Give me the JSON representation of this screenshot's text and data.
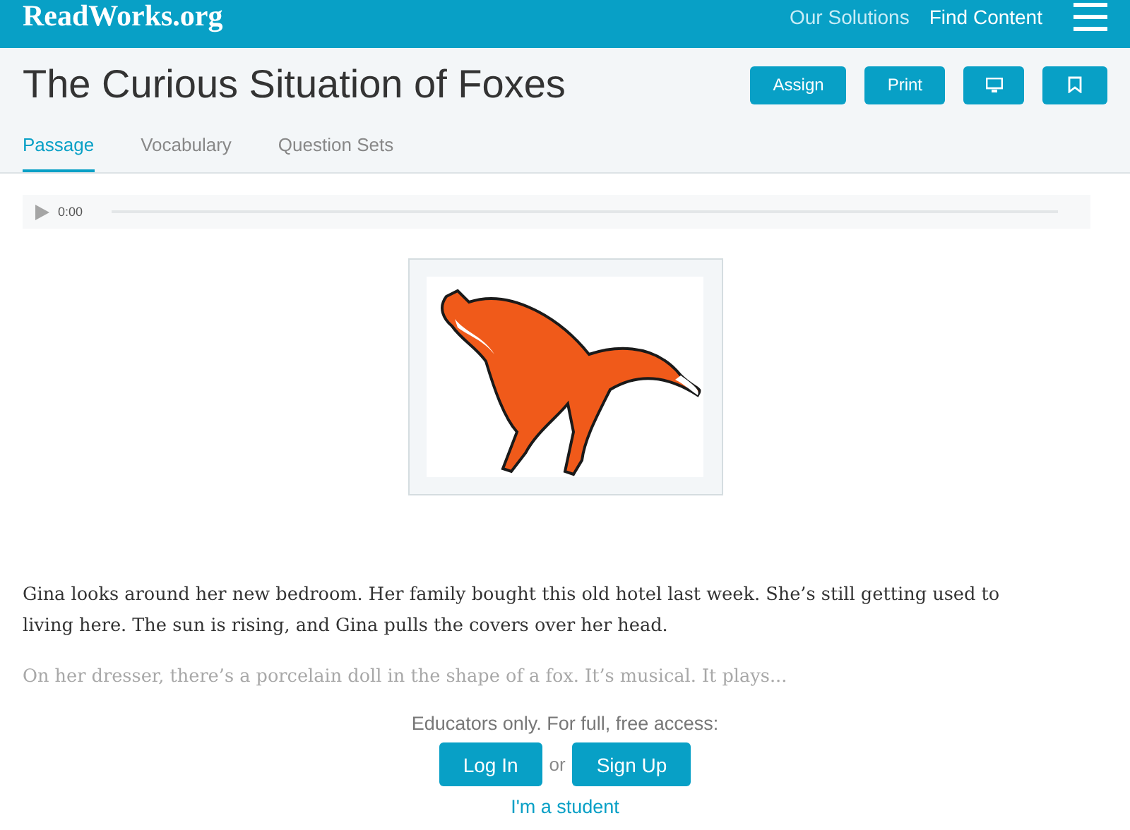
{
  "header": {
    "logo": "ReadWorks.org",
    "nav": [
      "Our Solutions",
      "Find Content"
    ]
  },
  "title": "The Curious Situation of Foxes",
  "actions": [
    {
      "kind": "text",
      "label": "Assign"
    },
    {
      "kind": "text",
      "label": "Print"
    },
    {
      "kind": "monitor"
    },
    {
      "kind": "bookmark"
    }
  ],
  "tabs": [
    {
      "label": "Passage",
      "selected": true
    },
    {
      "label": "Vocabulary",
      "selected": false
    },
    {
      "label": "Question Sets",
      "selected": false
    }
  ],
  "audio": {
    "time": "0:00"
  },
  "paragraphs": [
    {
      "text": "Gina looks around her new bedroom. Her family bought this old hotel last week. She’s still getting used to living here. The sun is rising, and Gina pulls the covers over her head.",
      "faded": false
    },
    {
      "text": "On her dresser, there’s a porcelain doll in the shape of a fox. It’s musical. It plays...",
      "faded": true
    }
  ],
  "access": {
    "message": "Educators only. For full, free access:",
    "login": "Log In",
    "or": "or",
    "signup": "Sign Up",
    "student": "I'm a student"
  }
}
